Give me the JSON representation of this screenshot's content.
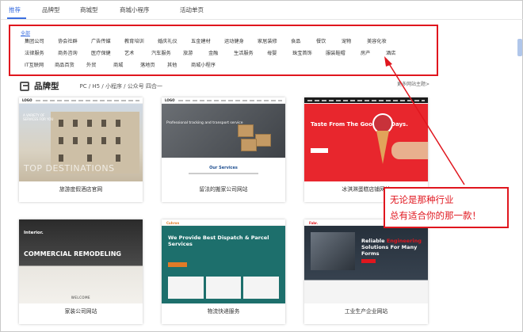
{
  "tabs": [
    "推荐",
    "品牌型",
    "商城型",
    "商城小程序",
    "活动单页"
  ],
  "categories": {
    "all_label": "全部",
    "row1": [
      "集团公司",
      "协会社群",
      "广告传媒",
      "教育培训",
      "婚庆礼仪",
      "五金建材",
      "运动健身",
      "家居装修",
      "食品",
      "餐饮",
      "宠物",
      "美容化妆"
    ],
    "row2": [
      "法律服务",
      "商务咨询",
      "医疗保健",
      "艺术",
      "汽车服务",
      "旅游",
      "金融",
      "生活服务",
      "母婴",
      "珠宝首饰",
      "服装鞋帽",
      "房产",
      "酒店"
    ],
    "row3": [
      "IT互联网",
      "商品百货",
      "外贸",
      "商城",
      "落地页",
      "其他",
      "商城小程序"
    ]
  },
  "section": {
    "title": "品牌型",
    "subtitle": "PC / H5 / 小程序 / 公众号 四合一",
    "more": "更多网站主题>"
  },
  "cards": [
    {
      "title": "旅游度假酒店官网",
      "thumb": {
        "logo": "LOGO",
        "text": "A VARIETY OF SERVICES FOR YOU",
        "big": "TOP DESTINATIONS"
      }
    },
    {
      "title": "留法的搬家公司网站",
      "thumb": {
        "logo": "LOGO",
        "text": "Professional tracking and transport service",
        "sub": "Our Services"
      }
    },
    {
      "title": "冰淇淋蛋糕店铺网站",
      "thumb": {
        "title": "Taste From The Good Old Days."
      }
    },
    {
      "title": "家装公司网站",
      "thumb": {
        "label": "Interior.",
        "title": "COMMERCIAL REMODELING",
        "welcome": "WELCOME"
      }
    },
    {
      "title": "物流快递服务",
      "thumb": {
        "logo": "Cuhron",
        "title": "We Provide Best Dispatch & Parcel Services"
      }
    },
    {
      "title": "工业生产企业网站",
      "thumb": {
        "logo": "Fabr.",
        "title_a": "Reliable ",
        "title_b": "Engineering",
        "title_c": "Solutions For Many Forms"
      }
    }
  ],
  "callout": {
    "line1": "无论是那种行业",
    "line2": "总有适合你的那一款！"
  },
  "colors": {
    "accent": "#3b6fe0",
    "highlight": "#e0161e"
  }
}
